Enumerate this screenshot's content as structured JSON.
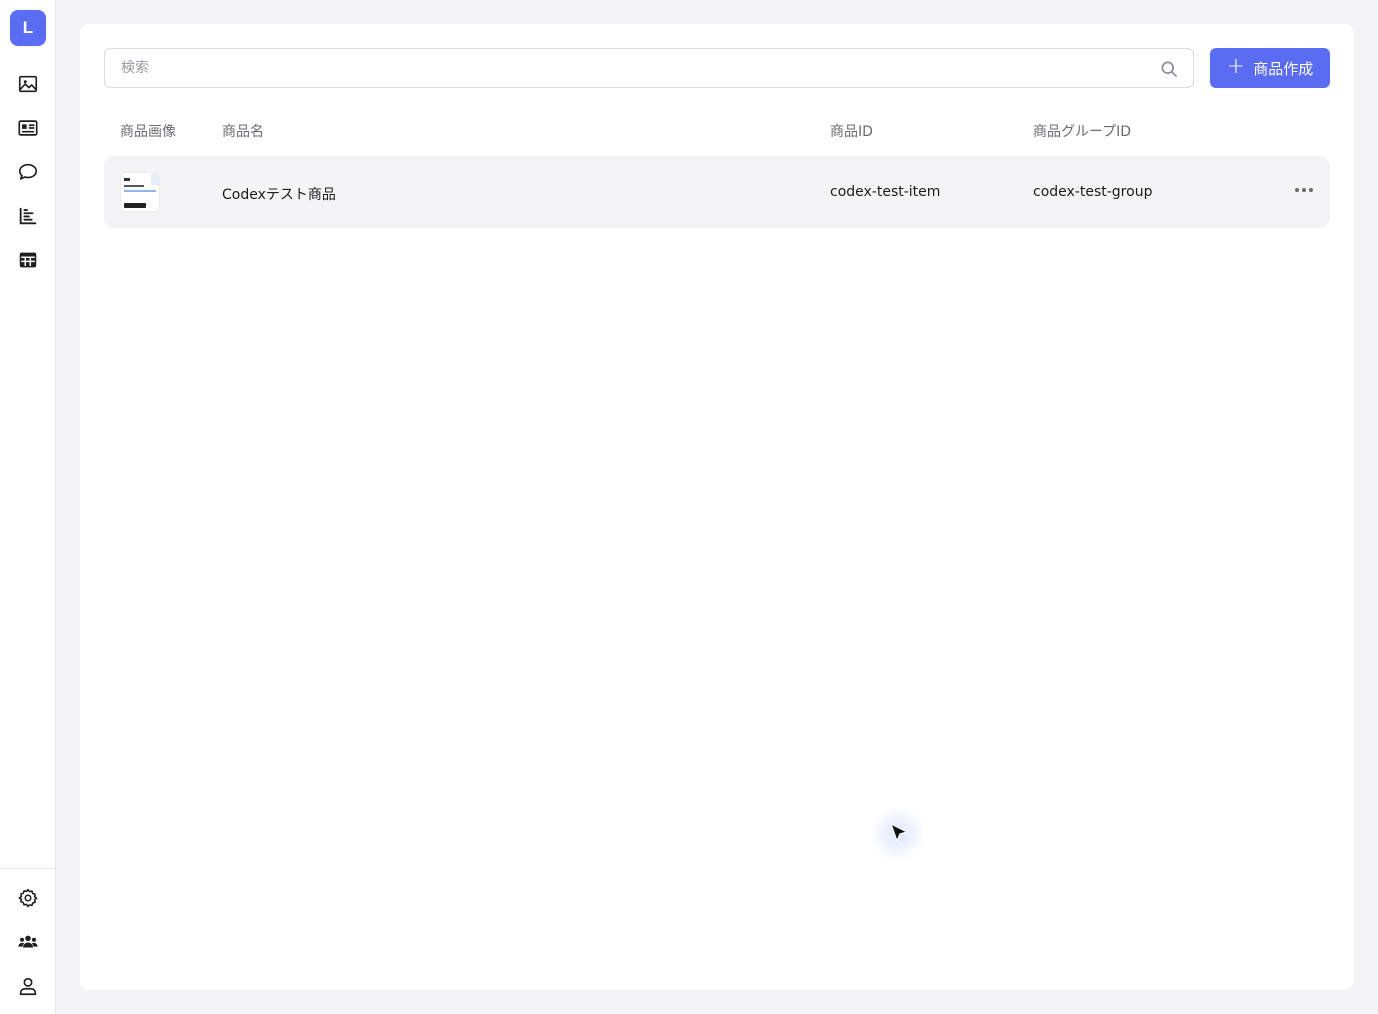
{
  "sidebar": {
    "avatar_letter": "L",
    "nav_items": [
      {
        "icon": "image-icon"
      },
      {
        "icon": "id-card-icon"
      },
      {
        "icon": "chat-bubble-icon"
      },
      {
        "icon": "bar-chart-icon"
      },
      {
        "icon": "table-grid-icon"
      }
    ],
    "bottom_items": [
      {
        "icon": "gear-icon"
      },
      {
        "icon": "users-icon"
      },
      {
        "icon": "user-icon"
      }
    ]
  },
  "toolbar": {
    "search_placeholder": "検索",
    "create_label": "商品作成",
    "create_icon": "+"
  },
  "table": {
    "headers": {
      "image": "商品画像",
      "name": "商品名",
      "id": "商品ID",
      "group_id": "商品グループID"
    },
    "rows": [
      {
        "name": "Codexテスト商品",
        "id": "codex-test-item",
        "group_id": "codex-test-group"
      }
    ]
  },
  "colors": {
    "accent": "#5a6cf2",
    "background": "#f4f4f6",
    "card": "#ffffff"
  }
}
